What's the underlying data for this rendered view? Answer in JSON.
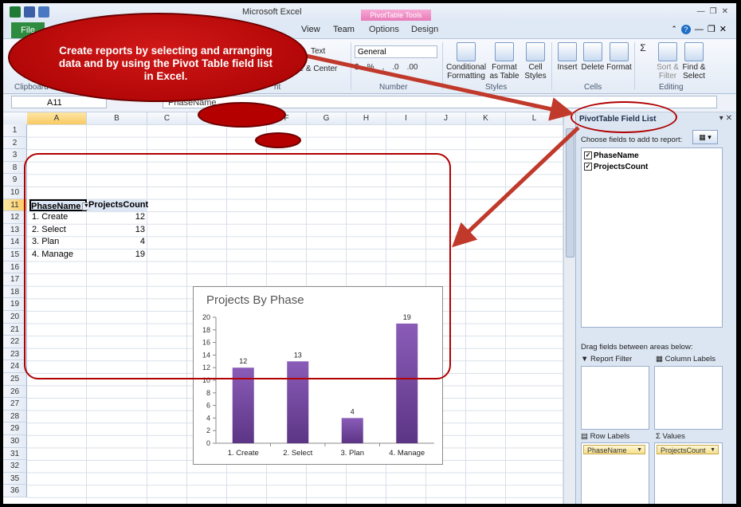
{
  "app": {
    "title": "Microsoft Excel",
    "context_tab_group": "PivotTable Tools"
  },
  "tabs": {
    "file": "File",
    "view": "View",
    "team": "Team",
    "options": "Options",
    "design": "Design"
  },
  "ribbon": {
    "clipboard_label": "Clipboard",
    "alignment_wrap": "Text",
    "alignment_merge": "ge & Center",
    "alignment_label": "nt",
    "number_format": "General",
    "number_label": "Number",
    "conditional_formatting": "Conditional\nFormatting",
    "format_as_table": "Format\nas Table",
    "cell_styles": "Cell\nStyles",
    "styles_label": "Styles",
    "insert": "Insert",
    "delete": "Delete",
    "format": "Format",
    "cells_label": "Cells",
    "sort_filter": "Sort &\nFilter",
    "find_select": "Find &\nSelect",
    "editing_label": "Editing"
  },
  "formula_bar": {
    "name_box": "A11",
    "formula": "PhaseName"
  },
  "grid": {
    "columns": [
      "A",
      "B",
      "C",
      "D",
      "E",
      "F",
      "G",
      "H",
      "I",
      "J",
      "K",
      "L"
    ],
    "rows": [
      "1",
      "2",
      "3",
      "8",
      "9",
      "10",
      "11",
      "12",
      "13",
      "14",
      "15",
      "16",
      "17",
      "18",
      "19",
      "20",
      "21",
      "22",
      "23",
      "24",
      "25",
      "26",
      "27",
      "28",
      "29",
      "30",
      "31",
      "32",
      "35",
      "36"
    ],
    "selected_column": "A",
    "selected_row": "11"
  },
  "pivot_table": {
    "header_phase": "PhaseName",
    "header_count": "ProjectsCount",
    "rows": [
      {
        "phase": "1. Create",
        "count": "12"
      },
      {
        "phase": "2. Select",
        "count": "13"
      },
      {
        "phase": "3. Plan",
        "count": "4"
      },
      {
        "phase": "4. Manage",
        "count": "19"
      }
    ]
  },
  "chart_data": {
    "type": "bar",
    "title": "Projects By Phase",
    "categories": [
      "1. Create",
      "2. Select",
      "3. Plan",
      "4. Manage"
    ],
    "values": [
      12,
      13,
      4,
      19
    ],
    "yticks": [
      0,
      2,
      4,
      6,
      8,
      10,
      12,
      14,
      16,
      18,
      20
    ],
    "ylim": [
      0,
      20
    ],
    "bar_color": "#7a4fa0",
    "xlabel": "",
    "ylabel": "",
    "data_labels": true,
    "legend": false
  },
  "field_list": {
    "title": "PivotTable Field List",
    "choose_label": "Choose fields to add to report:",
    "fields": [
      {
        "name": "PhaseName",
        "checked": true
      },
      {
        "name": "ProjectsCount",
        "checked": true
      }
    ],
    "drag_label": "Drag fields between areas below:",
    "report_filter": "Report Filter",
    "column_labels": "Column Labels",
    "row_labels": "Row Labels",
    "values": "Values",
    "row_chip": "PhaseName",
    "values_chip": "ProjectsCount"
  },
  "annotation": {
    "text": "Create reports by selecting and arranging data and by using the Pivot Table field list in Excel."
  }
}
